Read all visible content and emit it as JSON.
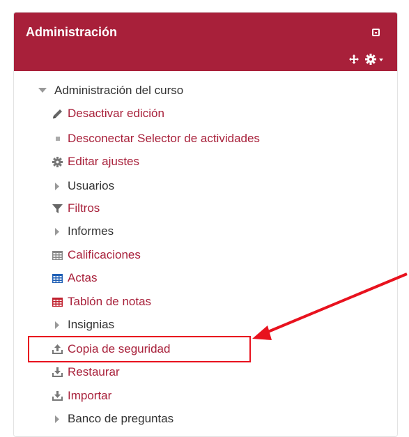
{
  "block": {
    "title": "Administración",
    "root_label": "Administración del curso",
    "items": [
      {
        "label": "Desactivar edición",
        "icon": "pencil-icon",
        "link": true
      },
      {
        "label": "Desconectar Selector de actividades",
        "icon": "square-bullet-icon",
        "link": true
      },
      {
        "label": "Editar ajustes",
        "icon": "gear-icon",
        "link": true
      },
      {
        "label": "Usuarios",
        "icon": "triangle-right-icon",
        "link": false
      },
      {
        "label": "Filtros",
        "icon": "filter-icon",
        "link": true
      },
      {
        "label": "Informes",
        "icon": "triangle-right-icon",
        "link": false
      },
      {
        "label": "Calificaciones",
        "icon": "grid-gray-icon",
        "link": true
      },
      {
        "label": "Actas",
        "icon": "grid-blue-icon",
        "link": true
      },
      {
        "label": "Tablón de notas",
        "icon": "grid-red-icon",
        "link": true
      },
      {
        "label": "Insignias",
        "icon": "triangle-right-icon",
        "link": false
      },
      {
        "label": "Copia de seguridad",
        "icon": "backup-icon",
        "link": true
      },
      {
        "label": "Restaurar",
        "icon": "restore-icon",
        "link": true
      },
      {
        "label": "Importar",
        "icon": "import-icon",
        "link": true
      },
      {
        "label": "Banco de preguntas",
        "icon": "triangle-right-icon",
        "link": false
      }
    ]
  },
  "colors": {
    "brand": "#a8203a",
    "highlight": "#e8121e",
    "text": "#333333"
  }
}
